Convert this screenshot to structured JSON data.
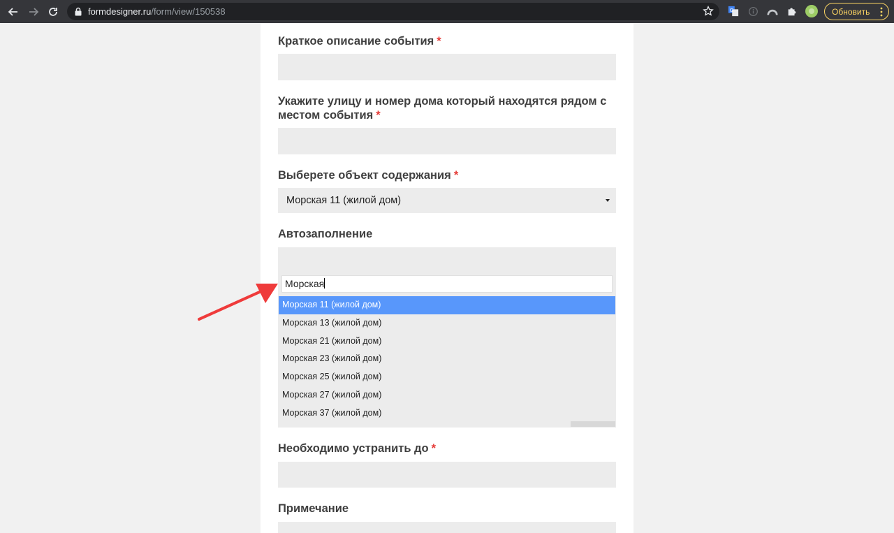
{
  "browser": {
    "url_host": "formdesigner.ru",
    "url_path": "/form/view/150538",
    "update_label": "Обновить",
    "colors": {
      "toolbar": "#35363a",
      "omnibox": "#202124",
      "update": "#fdd663"
    }
  },
  "form": {
    "required_mark": "*",
    "fields": {
      "short_description": {
        "label": "Краткое описание события"
      },
      "street": {
        "label_line1": "Укажите улицу и номер дома который находятся рядом с",
        "label_line2": "местом события"
      },
      "object": {
        "label": "Выберете объект содержания",
        "selected": "Морская 11 (жилой дом)"
      },
      "autofill": {
        "label": "Автозаполнение",
        "search_value": "Морская",
        "options": [
          "Морская 11 (жилой дом)",
          "Морская 13 (жилой дом)",
          "Морская 21 (жилой дом)",
          "Морская 23 (жилой дом)",
          "Морская 25 (жилой дом)",
          "Морская 27 (жилой дом)",
          "Морская 37 (жилой дом)"
        ],
        "highlighted_index": 0,
        "highlight_color": "#5897fb"
      },
      "deadline": {
        "label": "Необходимо устранить до"
      },
      "note": {
        "label": "Примечание"
      }
    },
    "colors": {
      "field_bg": "#ececec",
      "required": "#e53935",
      "label": "#3f3f3f"
    }
  }
}
